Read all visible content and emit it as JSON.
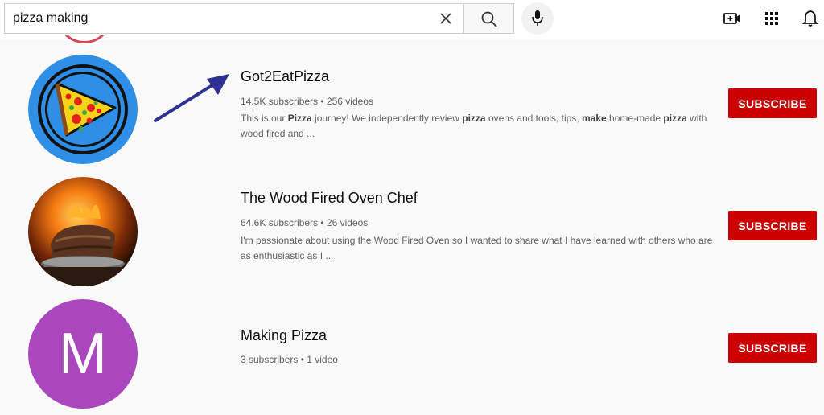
{
  "search": {
    "query": "pizza making"
  },
  "icons": {
    "clear": "close-icon",
    "search": "search-icon",
    "mic": "mic-icon",
    "create": "video-camera-plus-icon",
    "apps": "grid-apps-icon",
    "notifications": "bell-icon"
  },
  "colors": {
    "subscribe": "#cc0000",
    "letter_avatar": "#ab47bc",
    "arrow": "#2e3192"
  },
  "channels": [
    {
      "title": "Got2EatPizza",
      "meta": "14.5K subscribers • 256 videos",
      "description": "This is our **Pizza** journey! We independently review **pizza** ovens and tools, tips, **make** home-made **pizza** with wood fired and ...",
      "subscribe_label": "SUBSCRIBE"
    },
    {
      "title": "The Wood Fired Oven Chef",
      "meta": "64.6K subscribers • 26 videos",
      "description": "I'm passionate about using the Wood Fired Oven so I wanted to share what I have learned with others who are as enthusiastic as I ...",
      "subscribe_label": "SUBSCRIBE"
    },
    {
      "title": "Making Pizza",
      "avatar_letter": "M",
      "meta": "3 subscribers • 1 video",
      "subscribe_label": "SUBSCRIBE"
    }
  ]
}
